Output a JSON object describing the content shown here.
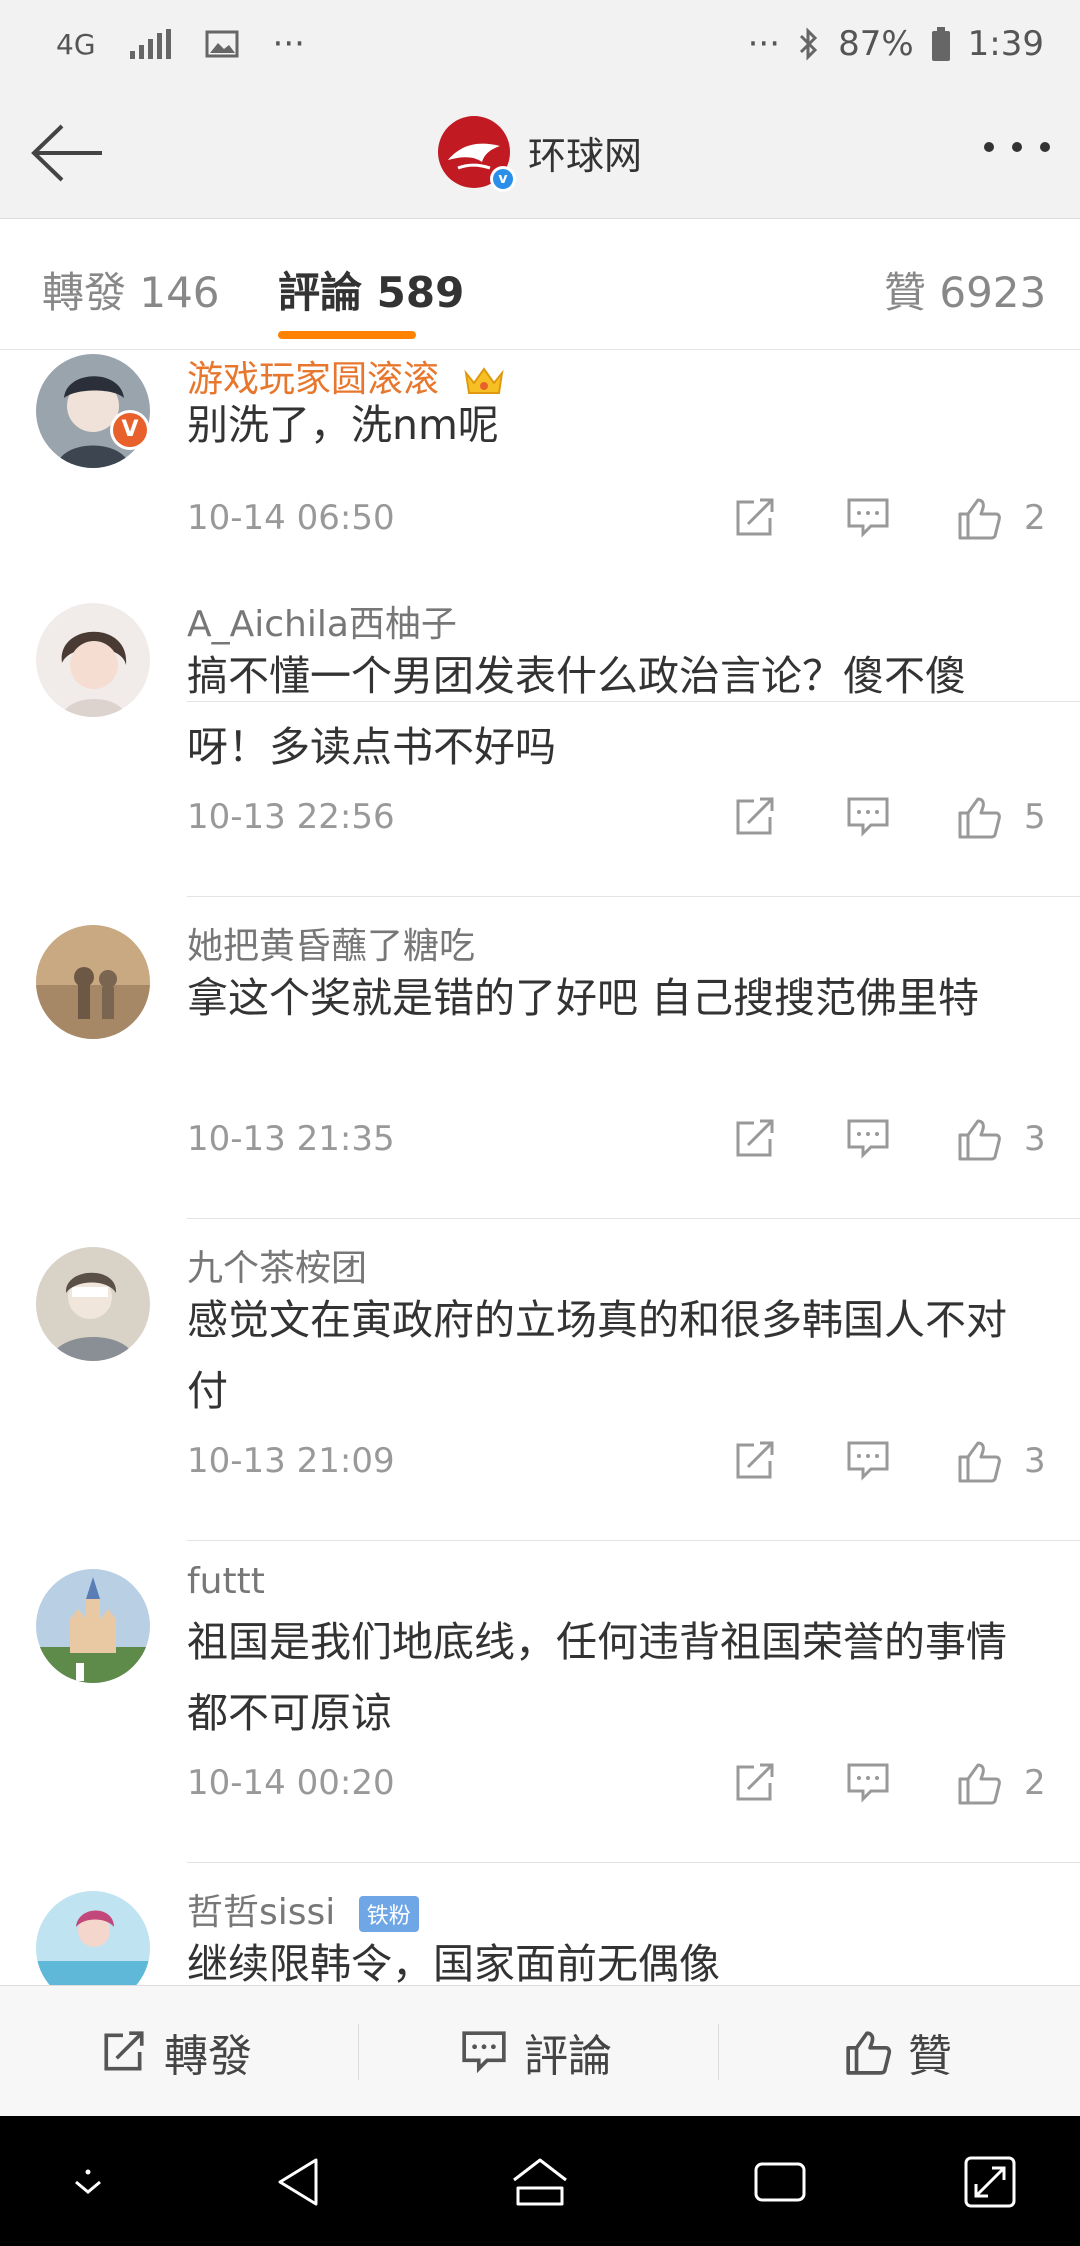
{
  "status_bar": {
    "network": "4G",
    "battery": "87%",
    "time": "1:39",
    "more": "···",
    "more_right": "···"
  },
  "nav": {
    "title": "环球网"
  },
  "tabs": [
    {
      "label": "轉發 146"
    },
    {
      "label": "評論 589"
    },
    {
      "label": "贊 6923"
    }
  ],
  "comments": [
    {
      "name": "游戏玩家圆滚滚",
      "text": "别洗了，洗nm呢",
      "time": "10-14 06:50",
      "likes": "2"
    },
    {
      "name": "A_Aichila西柚子",
      "text": "搞不懂一个男团发表什么政治言论？傻不傻呀！多读点书不好吗",
      "time": "10-13 22:56",
      "likes": "5"
    },
    {
      "name": "她把黄昏蘸了糖吃",
      "text": "拿这个奖就是错的了好吧 自己搜搜范佛里特",
      "time": "10-13 21:35",
      "likes": "3"
    },
    {
      "name": "九个茶桉团",
      "text": "感觉文在寅政府的立场真的和很多韩国人不对付",
      "time": "10-13 21:09",
      "likes": "3"
    },
    {
      "name": "futtt",
      "text": "祖国是我们地底线，任何违背祖国荣誉的事情都不可原谅",
      "time": "10-14 00:20",
      "likes": "2"
    },
    {
      "name": "哲哲sissi",
      "badge": "铁粉",
      "text": "继续限韩令，国家面前无偶像",
      "time": "",
      "likes": ""
    }
  ],
  "action_bar": {
    "repost": "轉發",
    "comment": "評論",
    "like": "贊"
  },
  "colors": {
    "accent": "#ff8200",
    "vip_name": "#e8772e",
    "brand": "#c11a22"
  }
}
